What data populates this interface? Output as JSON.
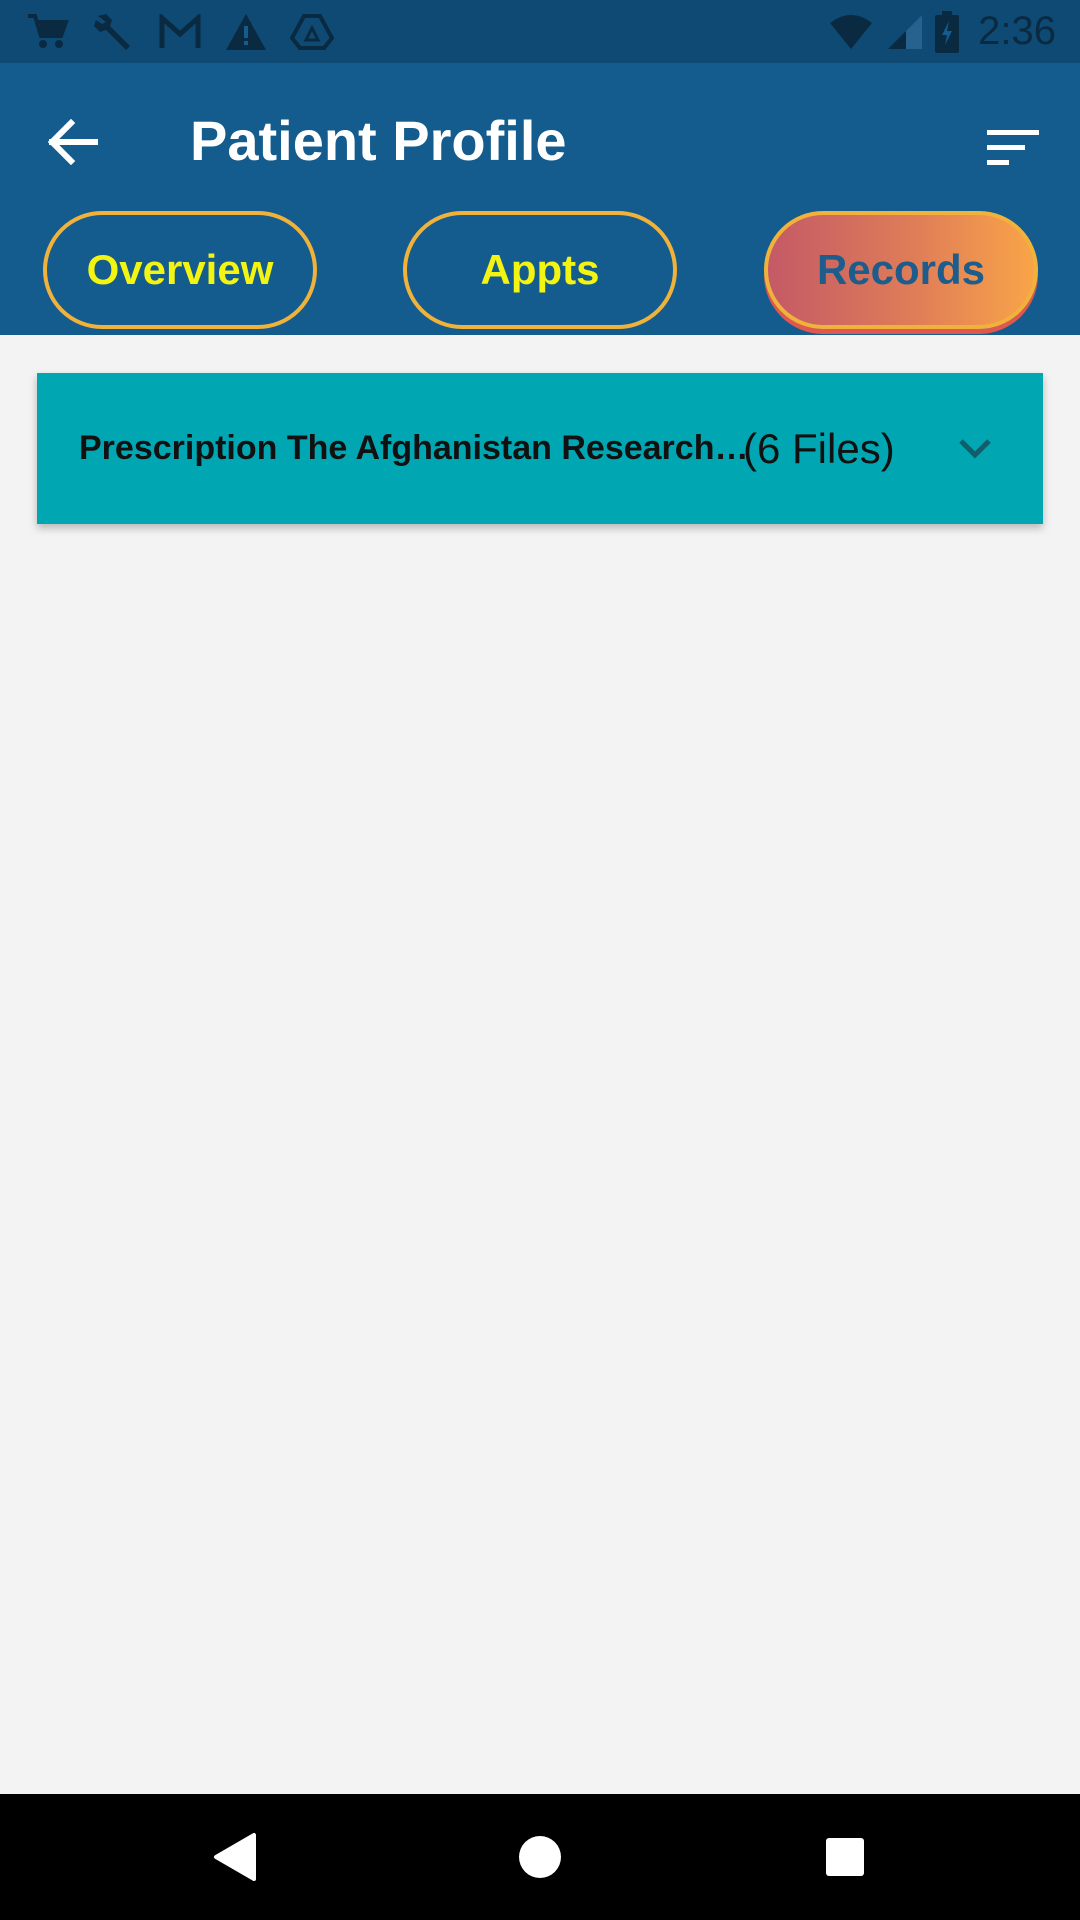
{
  "status_bar": {
    "time": "2:36",
    "notification_icons": [
      "shopping-cart-icon",
      "wrench-icon",
      "gmail-icon",
      "warning-icon",
      "drive-icon"
    ],
    "system_icons": [
      "wifi-icon",
      "signal-icon",
      "battery-charging-icon"
    ]
  },
  "app_bar": {
    "title": "Patient Profile",
    "back_icon": "arrow-left-icon",
    "sort_icon": "sort-icon"
  },
  "tabs": [
    {
      "label": "Overview",
      "active": false
    },
    {
      "label": "Appts",
      "active": false
    },
    {
      "label": "Records",
      "active": true
    }
  ],
  "records": [
    {
      "title": "Prescription The Afghanistan Research …",
      "count": "(6 Files)",
      "expand_icon": "chevron-down-icon"
    }
  ],
  "nav_bar": {
    "buttons": [
      "back-triangle-icon",
      "home-circle-icon",
      "recents-square-icon"
    ]
  },
  "colors": {
    "status_bar": "#0e4a74",
    "app_bar": "#135c8d",
    "tab_border": "#f0b23a",
    "tab_text": "#f4f413",
    "active_tab_text": "#1e5c8c",
    "card": "#00a7b3",
    "background": "#f3f3f3"
  }
}
